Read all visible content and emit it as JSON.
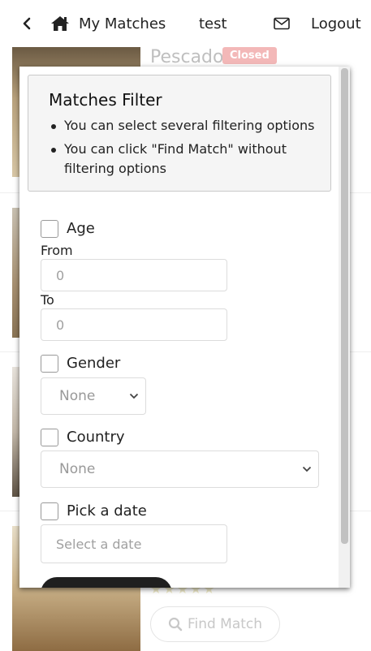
{
  "header": {
    "back_icon": "chevron-left-icon",
    "home_icon": "home-icon",
    "title": "My Matches",
    "username": "test",
    "mail_icon": "envelope-icon",
    "logout_label": "Logout"
  },
  "background": {
    "card_title": "Pescado",
    "card_badge": "Closed",
    "find_match_label": "Find Match",
    "find_match_icon": "search-icon"
  },
  "modal": {
    "title": "Matches Filter",
    "tips": [
      "You can select several filtering options",
      "You can click \"Find Match\" without filtering options"
    ],
    "age": {
      "label": "Age",
      "from_label": "From",
      "from_placeholder": "0",
      "to_label": "To",
      "to_placeholder": "0"
    },
    "gender": {
      "label": "Gender",
      "selected": "None"
    },
    "country": {
      "label": "Country",
      "selected": "None"
    },
    "date": {
      "label": "Pick a date",
      "placeholder": "Select a date"
    }
  },
  "colors": {
    "badge": "#f3b8b8",
    "muted_text": "#bfbfbf",
    "info_bg": "#f5f5f5",
    "dark_button": "#1f1f1f"
  }
}
